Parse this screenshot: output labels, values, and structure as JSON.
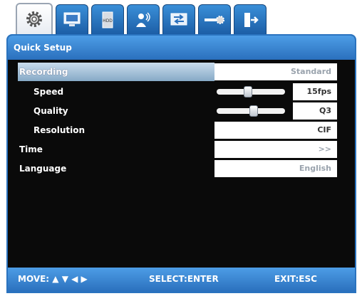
{
  "tabs": [
    {
      "icon": "settings-gear-icon"
    },
    {
      "icon": "display-monitor-icon"
    },
    {
      "icon": "hdd-icon"
    },
    {
      "icon": "user-sound-icon"
    },
    {
      "icon": "network-icon"
    },
    {
      "icon": "system-settings-icon"
    },
    {
      "icon": "exit-door-icon"
    }
  ],
  "window": {
    "title": "Quick Setup"
  },
  "menu": {
    "recording": {
      "label": "Recording",
      "value": "Standard"
    },
    "speed": {
      "label": "Speed",
      "value": "15fps",
      "level": 0.45
    },
    "quality": {
      "label": "Quality",
      "value": "Q3",
      "level": 0.55
    },
    "resolution": {
      "label": "Resolution",
      "value": "CIF"
    },
    "time": {
      "label": "Time",
      "value": ">>"
    },
    "language": {
      "label": "Language",
      "value": "English"
    }
  },
  "footer": {
    "move": "MOVE: ▲ ▼ ◀ ▶",
    "select": "SELECT:ENTER",
    "exit": "EXIT:ESC"
  },
  "colors": {
    "accent": "#2a70bd",
    "highlight": "#a9c6df",
    "background": "#0a0a0a"
  }
}
